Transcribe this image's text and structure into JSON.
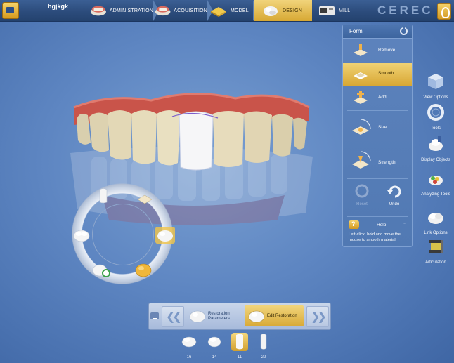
{
  "header": {
    "patient_name": "hgjkgk",
    "brand": "CEREC",
    "steps": [
      {
        "label": "ADMINISTRATION",
        "active": false
      },
      {
        "label": "ACQUISITION",
        "active": false
      },
      {
        "label": "MODEL",
        "active": false
      },
      {
        "label": "DESIGN",
        "active": true
      },
      {
        "label": "MILL",
        "active": false
      }
    ]
  },
  "form_panel": {
    "title": "Form",
    "tools": [
      {
        "label": "Remove",
        "active": false
      },
      {
        "label": "Smooth",
        "active": true
      },
      {
        "label": "Add",
        "active": false
      },
      {
        "label": "Size",
        "active": false
      },
      {
        "label": "Strength",
        "active": false
      }
    ],
    "reset_label": "Reset",
    "undo_label": "Undo",
    "help_label": "Help",
    "help_text": "Left-click, hold and move the mouse to smooth material."
  },
  "right_tools": [
    {
      "label": "View Options",
      "icon": "cube-view-icon"
    },
    {
      "label": "Tools",
      "icon": "tools-ring-icon"
    },
    {
      "label": "Display Objects",
      "icon": "display-objects-icon"
    },
    {
      "label": "Analyzing Tools",
      "icon": "analyzing-tools-icon"
    },
    {
      "label": "Link Options",
      "icon": "link-options-icon"
    },
    {
      "label": "Articulation",
      "icon": "articulation-icon"
    }
  ],
  "phase_nav": {
    "steps": [
      {
        "label": "Restoration Parameters",
        "active": false
      },
      {
        "label": "Edit Restoration",
        "active": true
      }
    ]
  },
  "tooth_selector": [
    {
      "number": "16",
      "selected": false
    },
    {
      "number": "14",
      "selected": false
    },
    {
      "number": "11",
      "selected": true
    },
    {
      "number": "22",
      "selected": false
    }
  ],
  "colors": {
    "accent_gold": "#d7a833",
    "panel_blue": "#5179b3",
    "background_blue": "#5e86c2",
    "gingiva_red": "#c4544a"
  }
}
